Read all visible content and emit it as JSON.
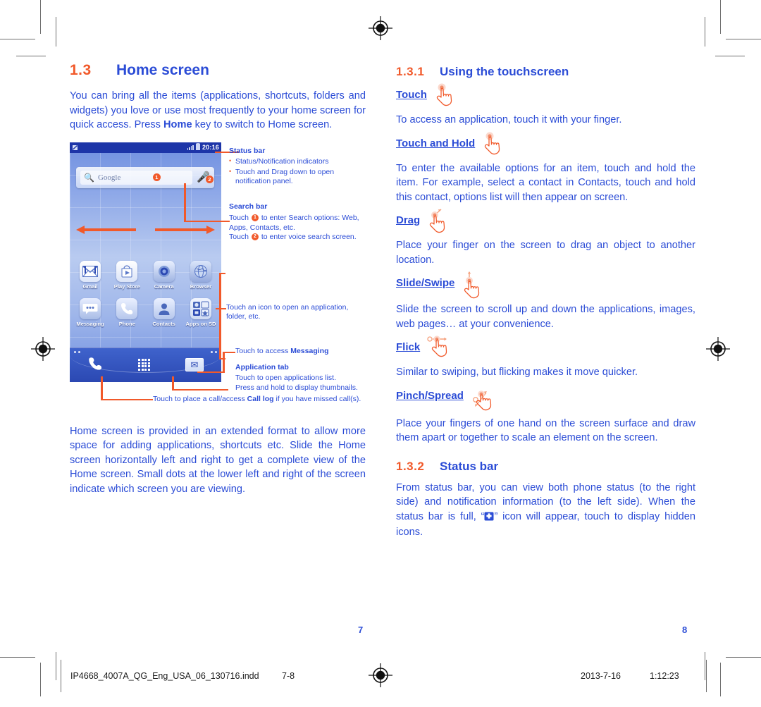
{
  "colors": {
    "orange": "#F1592A",
    "blue": "#2B4CD6",
    "dark_blue": "#1d35a8"
  },
  "left_page": {
    "section": {
      "number": "1.3",
      "title": "Home screen"
    },
    "intro": "You can bring all the items (applications, shortcuts, folders and widgets) you love or use most frequently to your home screen for quick access. Press Home key to switch to Home screen.",
    "intro_bold": "Home",
    "phone": {
      "status_bar": {
        "time": "20:16",
        "icons": [
          "notification-icon",
          "signal-icon",
          "battery-icon"
        ]
      },
      "search_widget": {
        "placeholder": "Google",
        "search_badge": "1",
        "voice_badge": "2"
      },
      "apps_row1": [
        {
          "label": "Gmail",
          "icon": "gmail-icon"
        },
        {
          "label": "Play Store",
          "icon": "play-store-icon"
        },
        {
          "label": "Camera",
          "icon": "camera-icon"
        },
        {
          "label": "Browser",
          "icon": "browser-icon"
        }
      ],
      "apps_row2": [
        {
          "label": "Messaging",
          "icon": "messaging-icon"
        },
        {
          "label": "Phone",
          "icon": "phone-icon"
        },
        {
          "label": "Contacts",
          "icon": "contacts-icon"
        },
        {
          "label": "Apps on SD",
          "icon": "apps-on-sd-icon"
        }
      ],
      "dock": [
        {
          "name": "phone-dock-icon"
        },
        {
          "name": "application-tab-icon"
        },
        {
          "name": "messaging-dock-icon"
        }
      ]
    },
    "callouts": {
      "status_bar": {
        "title": "Status bar",
        "bullets": [
          "Status/Notification indicators",
          "Touch and Drag down to open notification panel."
        ]
      },
      "search_bar": {
        "title": "Search bar",
        "line1_pre": "Touch ",
        "line1_post": " to enter Search options: Web, Apps, Contacts, etc.",
        "badge1": "1",
        "line2_pre": "Touch ",
        "line2_post": " to enter voice search screen.",
        "badge2": "2"
      },
      "icons_note": "Touch an icon to open an application, folder, etc.",
      "messaging_note_pre": "Touch to access ",
      "messaging_note_bold": "Messaging",
      "application_tab": {
        "title": "Application tab",
        "line1": "Touch to open applications list.",
        "line2": "Press and hold to display thumbnails."
      },
      "call_log_pre": "Touch to place a call/access ",
      "call_log_bold": "Call log",
      "call_log_post": " if you have missed call(s)."
    },
    "closing": "Home screen is provided in an extended format to allow more space for adding applications, shortcuts etc. Slide the Home screen horizontally left and right to get a complete view of the Home screen. Small dots at the lower left and right of the screen indicate which screen you are viewing.",
    "page_number": "7"
  },
  "right_page": {
    "section_1": {
      "number": "1.3.1",
      "title": "Using the touchscreen"
    },
    "gestures": [
      {
        "title": "Touch",
        "icon": "hand-touch-icon",
        "body": "To access an application, touch it with your finger."
      },
      {
        "title": "Touch and Hold",
        "icon": "hand-touch-hold-icon",
        "body": "To enter the available options for an item, touch and hold the item. For example, select a contact in Contacts, touch and hold this contact, options list will then appear on screen."
      },
      {
        "title": "Drag",
        "icon": "hand-drag-icon",
        "body": "Place your finger on the screen to drag an object to another location."
      },
      {
        "title": "Slide/Swipe",
        "icon": "hand-slide-icon",
        "body": "Slide the screen to scroll up and down the applications, images, web pages… at your convenience."
      },
      {
        "title": "Flick",
        "icon": "hand-flick-icon",
        "body": "Similar to swiping, but flicking makes it move quicker."
      },
      {
        "title": "Pinch/Spread",
        "icon": "hand-pinch-icon",
        "body": "Place your fingers of one hand on the screen surface and draw them apart or together to scale an element on the screen."
      }
    ],
    "section_2": {
      "number": "1.3.2",
      "title": "Status bar"
    },
    "status_bar_body_pre": "From status bar, you can view both phone status (to the right side) and notification information (to the left side). When the status bar is full, “",
    "status_bar_body_post": "” icon will appear, touch to display hidden icons.",
    "status_bar_inline_icon": "more-notifications-icon",
    "page_number": "8"
  },
  "footer": {
    "filename": "IP4668_4007A_QG_Eng_USA_06_130716.indd",
    "pages": "7-8",
    "date": "2013-7-16",
    "time": "1:12:23",
    "registration_icon": "registration-target-icon"
  }
}
